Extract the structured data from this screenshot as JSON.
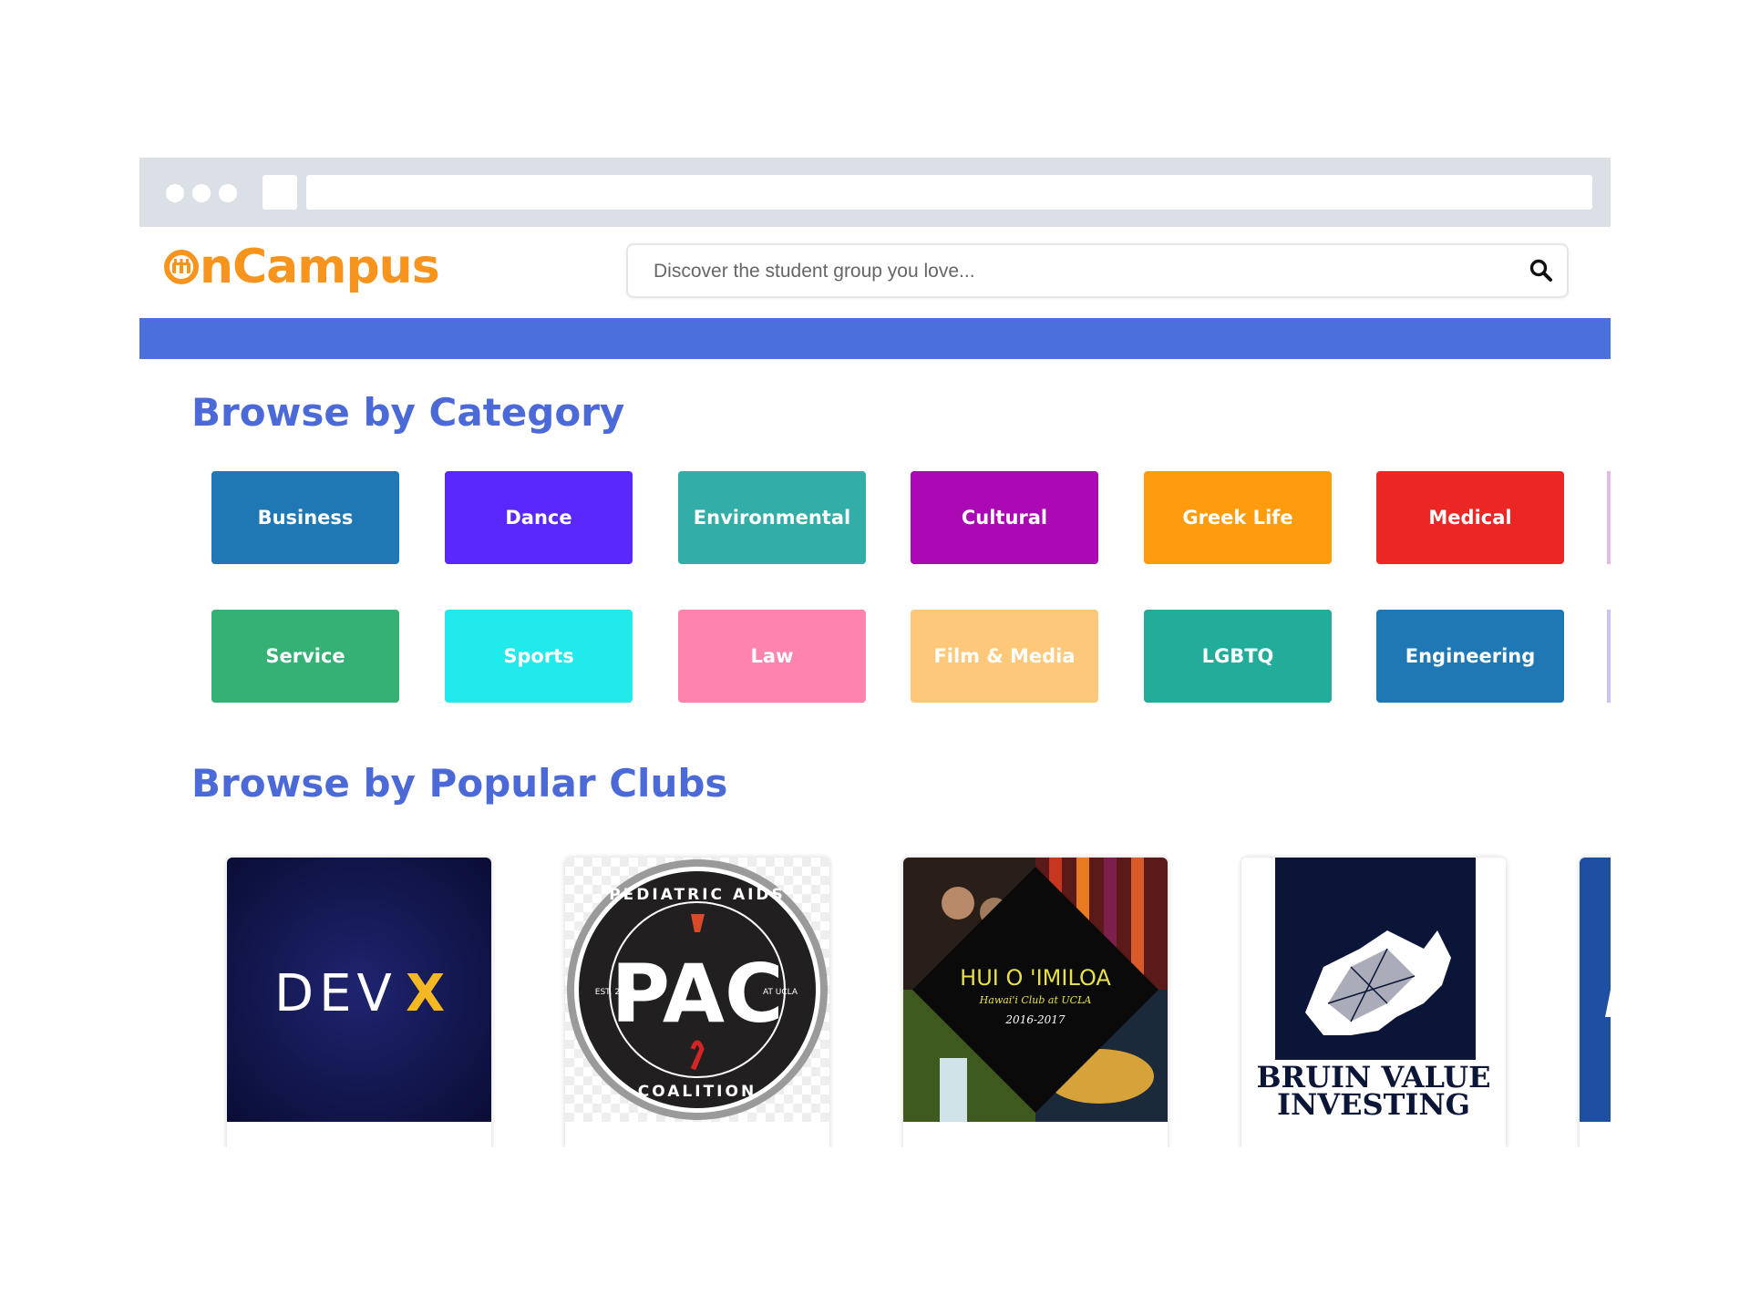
{
  "header": {
    "logo_text": "nCampus",
    "search_placeholder": "Discover the student group you love..."
  },
  "colors": {
    "brand_orange": "#f7941d",
    "band_blue": "#4c6fde",
    "title_blue": "#4b6ad8"
  },
  "icons": {
    "logo": "oncampus-o-icon",
    "search": "search-icon"
  },
  "sections": {
    "category_title": "Browse by Category",
    "popular_title": "Browse by Popular Clubs"
  },
  "categories": [
    {
      "label": "Business",
      "color": "#1f78b4"
    },
    {
      "label": "Dance",
      "color": "#5a27fc"
    },
    {
      "label": "Environmental",
      "color": "#33ada7"
    },
    {
      "label": "Cultural",
      "color": "#aa09b3"
    },
    {
      "label": "Greek Life",
      "color": "#fe9c0d"
    },
    {
      "label": "Medical",
      "color": "#ec2525"
    },
    {
      "label": "Service",
      "color": "#35b175"
    },
    {
      "label": "Sports",
      "color": "#22e9ec"
    },
    {
      "label": "Law",
      "color": "#fe83af"
    },
    {
      "label": "Film & Media",
      "color": "#fec87a"
    },
    {
      "label": "LGBTQ",
      "color": "#21ad99"
    },
    {
      "label": "Engineering",
      "color": "#1f78b4"
    }
  ],
  "clubs": [
    {
      "name": "devx",
      "logo_text_1": "DEV",
      "logo_text_2": "X"
    },
    {
      "name": "pac",
      "logo_text": "PAC",
      "ring_top": "PEDIATRIC AIDS",
      "ring_bottom": "COALITION",
      "est": "EST. 2010",
      "at": "AT UCLA"
    },
    {
      "name": "hui-o-imiloa",
      "logo_text": "HUI O 'IMILOA",
      "sub": "Hawai'i Club at UCLA",
      "years": "2016-2017"
    },
    {
      "name": "bruin-value-investing",
      "logo_line_1": "BRUIN VALUE",
      "logo_line_2": "INVESTING"
    }
  ]
}
